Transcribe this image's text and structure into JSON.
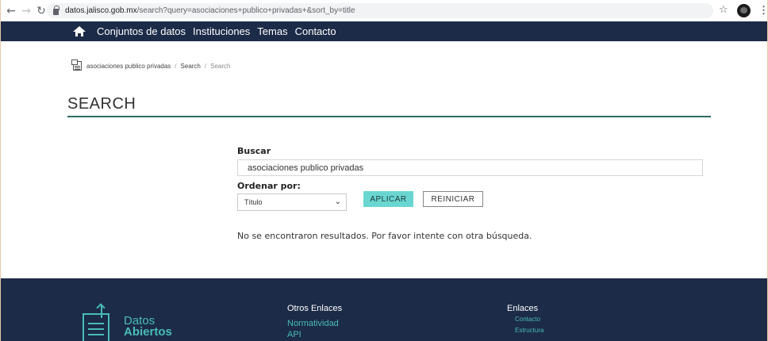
{
  "browser": {
    "url_domain": "datos.jalisco.gob.mx",
    "url_path": "/search?query=asociaciones+publico+privadas+&sort_by=title"
  },
  "nav": {
    "items": [
      "Conjuntos de datos",
      "Instituciones",
      "Temas",
      "Contacto"
    ]
  },
  "breadcrumb": {
    "items": [
      "asociaciones publico privadas",
      "Search",
      "Search"
    ],
    "separator": "/"
  },
  "page": {
    "title": "SEARCH"
  },
  "form": {
    "search_label": "Buscar",
    "search_value": "asociaciones publico privadas",
    "sort_label": "Ordenar por:",
    "sort_selected": "Título",
    "apply_label": "APLICAR",
    "reset_label": "REINICIAR"
  },
  "results": {
    "message": "No se encontraron resultados. Por favor intente con otra búsqueda."
  },
  "footer": {
    "logo_line1": "Datos",
    "logo_line2": "Abiertos",
    "col1_title": "Otros Enlaces",
    "col1_links": [
      "Normatividad",
      "API"
    ],
    "col2_title": "Enlaces",
    "col2_links": [
      "Contacto",
      "Estructura"
    ]
  },
  "colors": {
    "nav_bg": "#1c2b48",
    "accent_teal": "#6ad6d2",
    "footer_link": "#48bdb6",
    "title_rule": "#2f6b62"
  }
}
